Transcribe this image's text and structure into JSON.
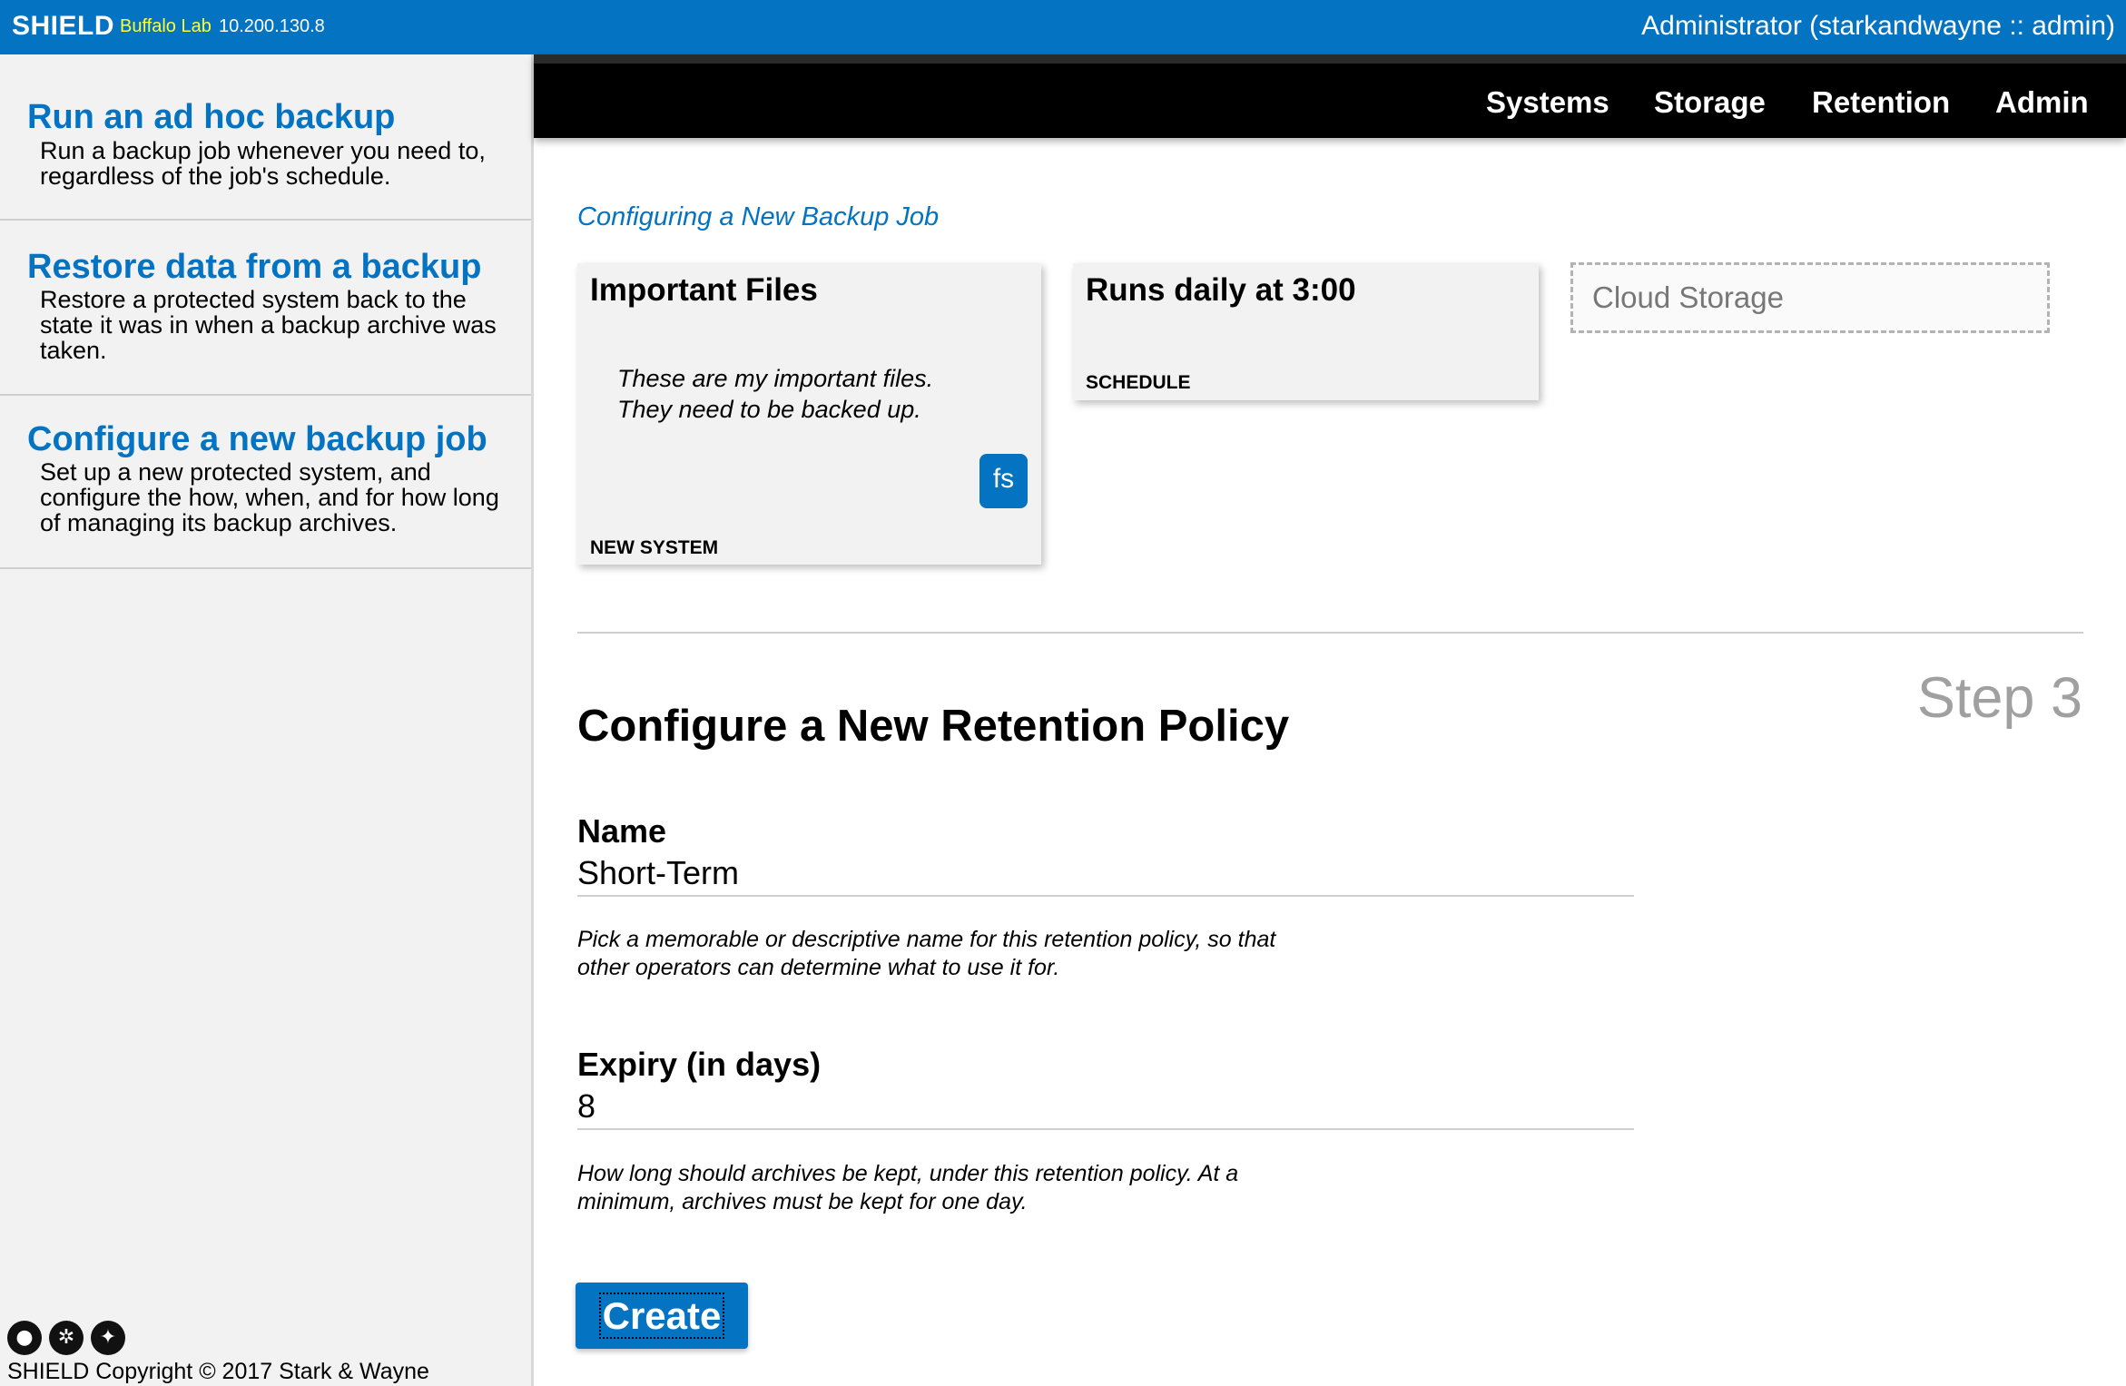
{
  "topbar": {
    "brand": "SHIELD",
    "environment": "Buffalo Lab",
    "ip": "10.200.130.8",
    "user": "Administrator (starkandwayne :: admin)"
  },
  "sidebar": {
    "items": [
      {
        "title": "Run an ad hoc backup",
        "desc": "Run a backup job whenever you need to, regardless of the job's schedule."
      },
      {
        "title": "Restore data from a backup",
        "desc": "Restore a protected system back to the state it was in when a backup archive was taken."
      },
      {
        "title": "Configure a new backup job",
        "desc": "Set up a new protected system, and configure the how, when, and for how long of managing its backup archives."
      }
    ],
    "icons": [
      "github-icon",
      "settings-icon",
      "twitter-icon"
    ],
    "copyright": "SHIELD Copyright © 2017 Stark & Wayne"
  },
  "nav": {
    "items": [
      "Systems",
      "Storage",
      "Retention",
      "Admin"
    ]
  },
  "main": {
    "breadcrumb": "Configuring a New Backup Job",
    "cards": {
      "system": {
        "title": "Important Files",
        "desc_line1": "These are my important files.",
        "desc_line2": "They need to be backed up.",
        "badge": "fs",
        "label": "NEW SYSTEM"
      },
      "schedule": {
        "title": "Runs daily at 3:00",
        "label": "SCHEDULE"
      },
      "storage": {
        "placeholder": "Cloud Storage"
      }
    },
    "step": "Step 3",
    "section_title": "Configure a New Retention Policy",
    "form": {
      "name_label": "Name",
      "name_value": "Short-Term",
      "name_help": "Pick a memorable or descriptive name for this retention policy, so that other operators can determine what to use it for.",
      "expiry_label": "Expiry (in days)",
      "expiry_value": "8",
      "expiry_help": "How long should archives be kept, under this retention policy. At a minimum, archives must be kept for one day.",
      "create_label": "Create"
    }
  },
  "colors": {
    "brand_blue": "#0373c2",
    "env_yellow": "#ffff33",
    "nav_black": "#000000"
  }
}
